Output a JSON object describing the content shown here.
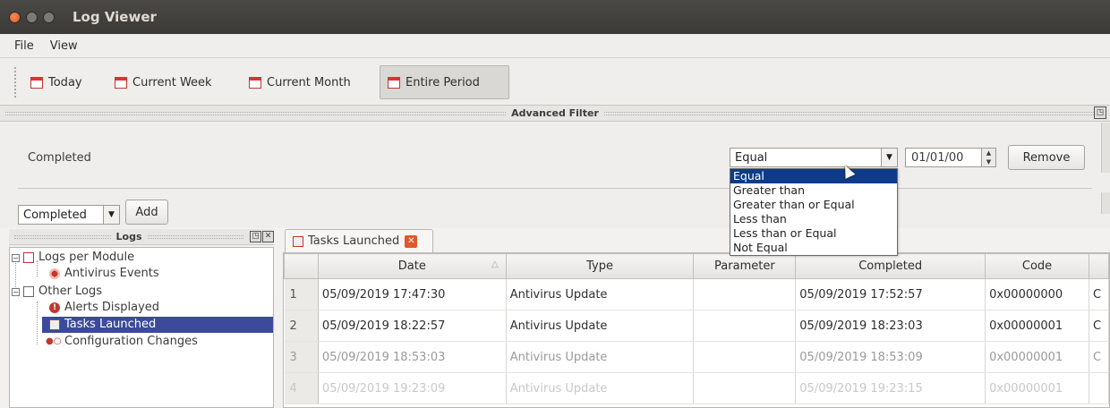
{
  "window": {
    "title": "Log Viewer"
  },
  "menu": {
    "file": "File",
    "view": "View"
  },
  "toolbar": {
    "today": "Today",
    "current_week": "Current Week",
    "current_month": "Current Month",
    "entire_period": "Entire Period"
  },
  "advanced_filter": {
    "header": "Advanced Filter",
    "filter_field_label": "Completed",
    "operator_value": "Equal",
    "date_value": "01/01/00",
    "remove_label": "Remove",
    "column_select_value": "Completed",
    "add_label": "Add",
    "operator_options": [
      "Equal",
      "Greater than",
      "Greater than or Equal",
      "Less than",
      "Less than or Equal",
      "Not Equal"
    ]
  },
  "logs_panel": {
    "header": "Logs",
    "tree": {
      "logs_per_module": "Logs per Module",
      "antivirus_events": "Antivirus Events",
      "other_logs": "Other Logs",
      "alerts_displayed": "Alerts Displayed",
      "tasks_launched": "Tasks Launched",
      "configuration_changes": "Configuration Changes"
    }
  },
  "tab": {
    "label": "Tasks Launched"
  },
  "table": {
    "columns": [
      "Date",
      "Type",
      "Parameter",
      "Completed",
      "Code"
    ],
    "rows": [
      {
        "n": "1",
        "date": "05/09/2019 17:47:30",
        "type": "Antivirus Update",
        "parameter": "",
        "completed": "05/09/2019 17:52:57",
        "code": "0x00000000",
        "extra": "C"
      },
      {
        "n": "2",
        "date": "05/09/2019 18:22:57",
        "type": "Antivirus Update",
        "parameter": "",
        "completed": "05/09/2019 18:23:03",
        "code": "0x00000001",
        "extra": "C"
      },
      {
        "n": "3",
        "date": "05/09/2019 18:53:03",
        "type": "Antivirus Update",
        "parameter": "",
        "completed": "05/09/2019 18:53:09",
        "code": "0x00000001",
        "extra": "C"
      },
      {
        "n": "4",
        "date": "05/09/2019 19:23:09",
        "type": "Antivirus Update",
        "parameter": "",
        "completed": "05/09/2019 19:23:15",
        "code": "0x00000001",
        "extra": ""
      }
    ]
  }
}
